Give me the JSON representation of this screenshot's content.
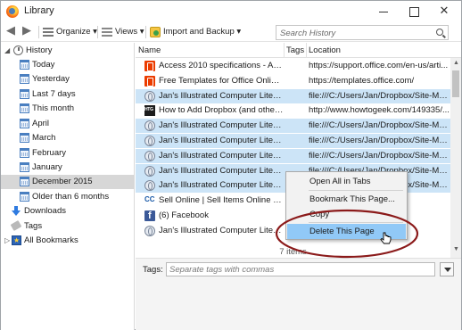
{
  "window": {
    "title": "Library",
    "controls": {
      "minimize": "",
      "maximize": "",
      "close": "✕"
    }
  },
  "toolbar": {
    "back_icon": "arrow-left-icon",
    "forward_icon": "arrow-right-icon",
    "organize_label": "Organize ▾",
    "views_label": "Views ▾",
    "import_label": "Import and Backup ▾",
    "search_placeholder": "Search History"
  },
  "sidebar": {
    "history": {
      "label": "History",
      "twisty": "◢",
      "icon": "history-icon"
    },
    "history_items": [
      {
        "label": "Today"
      },
      {
        "label": "Yesterday"
      },
      {
        "label": "Last 7 days"
      },
      {
        "label": "This month"
      },
      {
        "label": "April"
      },
      {
        "label": "March"
      },
      {
        "label": "February"
      },
      {
        "label": "January"
      },
      {
        "label": "December 2015",
        "selected": true
      },
      {
        "label": "Older than 6 months"
      }
    ],
    "downloads": {
      "label": "Downloads",
      "icon": "download-icon"
    },
    "tags": {
      "label": "Tags",
      "icon": "tag-icon"
    },
    "bookmarks": {
      "label": "All Bookmarks",
      "twisty": "▷",
      "icon": "bookmarks-icon"
    }
  },
  "list": {
    "columns": {
      "name": "Name",
      "tags": "Tags",
      "location": "Location"
    },
    "rows": [
      {
        "name": "Access 2010 specifications - Access",
        "location": "https://support.office.com/en-us/arti...",
        "favicon": "office-icon",
        "selected": false
      },
      {
        "name": "Free Templates for Office Online ...",
        "location": "https://templates.office.com/",
        "favicon": "office-icon",
        "selected": false
      },
      {
        "name": "Jan's Illustrated Computer Litera...",
        "location": "file:///C:/Users/Jan/Dropbox/Site-Mo...",
        "favicon": "globe-icon",
        "selected": true
      },
      {
        "name": "How to Add Dropbox (and other ...",
        "location": "http://www.howtogeek.com/149335/...",
        "favicon": "htg-icon",
        "selected": false
      },
      {
        "name": "Jan's Illustrated Computer Litera...",
        "location": "file:///C:/Users/Jan/Dropbox/Site-Mo...",
        "favicon": "globe-icon",
        "selected": true
      },
      {
        "name": "Jan's Illustrated Computer Litera...",
        "location": "file:///C:/Users/Jan/Dropbox/Site-Mo...",
        "favicon": "globe-icon",
        "selected": true
      },
      {
        "name": "Jan's Illustrated Computer Litera...",
        "location": "file:///C:/Users/Jan/Dropbox/Site-Mo...",
        "favicon": "globe-icon",
        "selected": true
      },
      {
        "name": "Jan's Illustrated Computer Litera...",
        "location": "file:///C:/Users/Jan/Dropbox/Site-Mo...",
        "favicon": "globe-icon",
        "selected": true
      },
      {
        "name": "Jan's Illustrated Computer Litera...",
        "location": "file:///C:/Users/Jan/Dropbox/Site-Mo...",
        "favicon": "globe-icon",
        "selected": true
      },
      {
        "name": "Sell Online | Sell Items Online | Ac...",
        "location": "",
        "favicon": "cc-icon",
        "selected": false
      },
      {
        "name": "(6) Facebook",
        "location": "",
        "favicon": "facebook-icon",
        "selected": false
      },
      {
        "name": "Jan's Illustrated Computer Litera...",
        "location": "",
        "favicon": "globe-icon",
        "selected": false
      }
    ],
    "items_count": "7 items"
  },
  "details": {
    "tags_label": "Tags:",
    "tags_placeholder": "Separate tags with commas"
  },
  "context_menu": {
    "items": [
      {
        "label": "Open All in Tabs"
      },
      {
        "label": "Bookmark This Page..."
      },
      {
        "label": "Copy"
      },
      {
        "label": "Delete This Page",
        "active": true
      }
    ]
  },
  "colors": {
    "selection": "#cce4f7",
    "menu_highlight": "#91c9f7",
    "annotation": "#8b1a1a"
  }
}
